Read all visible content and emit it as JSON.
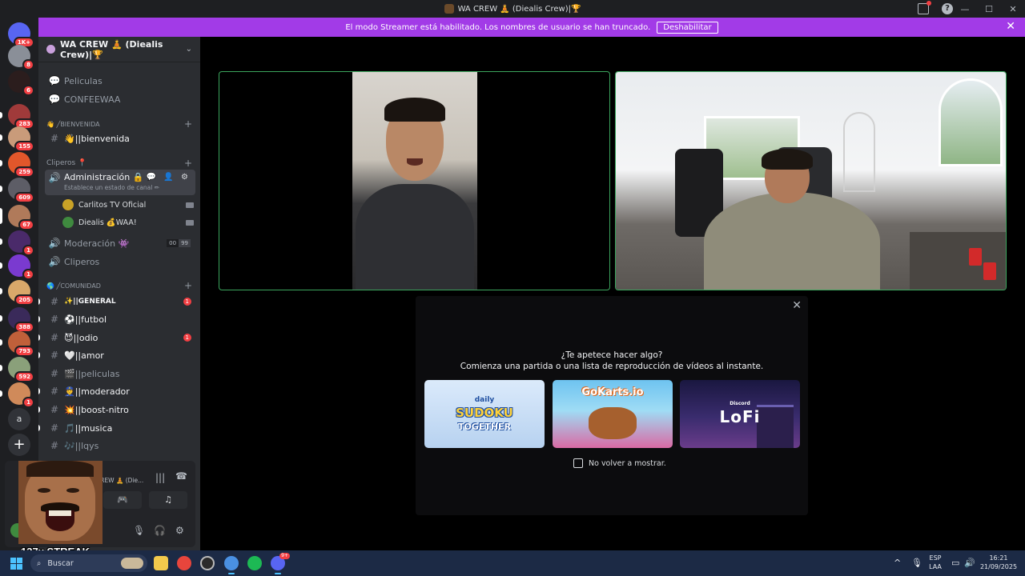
{
  "window": {
    "title": "WA CREW 🧘 (Diealis Crew)|🏆",
    "help_glyph": "?",
    "minimize": "—",
    "maximize": "☐",
    "close": "✕"
  },
  "banner": {
    "text": "El modo Streamer está habilitado. Los nombres de usuario se han truncado.",
    "button": "Deshabilitar",
    "close": "✕"
  },
  "rail": {
    "badges": [
      "1K+",
      "8",
      "6",
      "283",
      "155",
      "259",
      "609",
      "67",
      "1",
      "1",
      "205",
      "388",
      "793",
      "592",
      "1"
    ],
    "letter": "a",
    "add": "+"
  },
  "server": {
    "name": "WA CREW 🧘 (Diealis Crew)|🏆",
    "chevron": "⌄"
  },
  "channels": {
    "top": [
      {
        "icon": "💬",
        "name": "Peliculas"
      },
      {
        "icon": "💬",
        "name": "CONFEEWAA"
      }
    ],
    "cat_bienvenida": "👋 ╱BIENVENIDA",
    "bienvenida": {
      "icon": "#",
      "name": "👋||bienvenida"
    },
    "cat_clipers": "Cliperos 📍",
    "admin": {
      "icon": "🔊",
      "name": "Administración 🔒",
      "sub": "Establece un estado de canal ✏",
      "tools": "💬 👤 ⚙"
    },
    "voice_users": [
      {
        "name": "Carlitos TV Oficial",
        "color": "#c9a227"
      },
      {
        "name": "Diealis 💰WAA!",
        "color": "#3f8a3f"
      }
    ],
    "moderacion": {
      "icon": "🔊",
      "name": "Moderación 👾",
      "count_a": "00",
      "count_b": "99"
    },
    "cliperos_voice": {
      "icon": "🔊",
      "name": "Cliperos"
    },
    "cat_comunidad": "🌎 ╱COMUNIDAD",
    "list": [
      {
        "icon": "#",
        "name": "✨||GENERAL",
        "badge": "1",
        "bright": true
      },
      {
        "icon": "#",
        "name": "⚽||futbol",
        "badge": "",
        "bright": true
      },
      {
        "icon": "#",
        "name": "😈||odio",
        "badge": "1",
        "bright": true
      },
      {
        "icon": "#",
        "name": "🤍||amor",
        "badge": "",
        "bright": true
      },
      {
        "icon": "#",
        "name": "🎬||peliculas",
        "badge": "",
        "bright": false
      },
      {
        "icon": "#",
        "name": "👮||moderador",
        "badge": "",
        "bright": true
      },
      {
        "icon": "#",
        "name": "💥||boost-nitro",
        "badge": "",
        "bright": true
      },
      {
        "icon": "#",
        "name": "🎵||musica",
        "badge": "",
        "bright": true
      },
      {
        "icon": "#",
        "name": "🎶||lqys",
        "badge": "",
        "bright": false
      }
    ],
    "add": "+"
  },
  "userpanel": {
    "channel_label": "CREW 🧘 (Die...",
    "streak": "137x STREAK",
    "mic": "🎙",
    "headset": "🎧",
    "settings": "⚙"
  },
  "activity": {
    "line1": "¿Te apetece hacer algo?",
    "line2": "Comienza una partida o una lista de reproducción de vídeos al instante.",
    "close": "✕",
    "cards": [
      {
        "l1": "daily",
        "l2": "SUDOKU",
        "l3": "TOGETHER"
      },
      {
        "l1": "GoKarts.io"
      },
      {
        "l1": "Discord",
        "l2": "LoFi"
      }
    ],
    "checkbox": "No volver a mostrar."
  },
  "taskbar": {
    "search": "Buscar",
    "lang_top": "ESP",
    "lang_bottom": "LAA",
    "time": "16:21",
    "date": "21/09/2025",
    "discord_badge": "9+"
  },
  "colors": {
    "banner": "#a23be7",
    "speaking_border": "#3ba55d",
    "badge_red": "#f23f43",
    "taskbar": "#1c2a45"
  }
}
